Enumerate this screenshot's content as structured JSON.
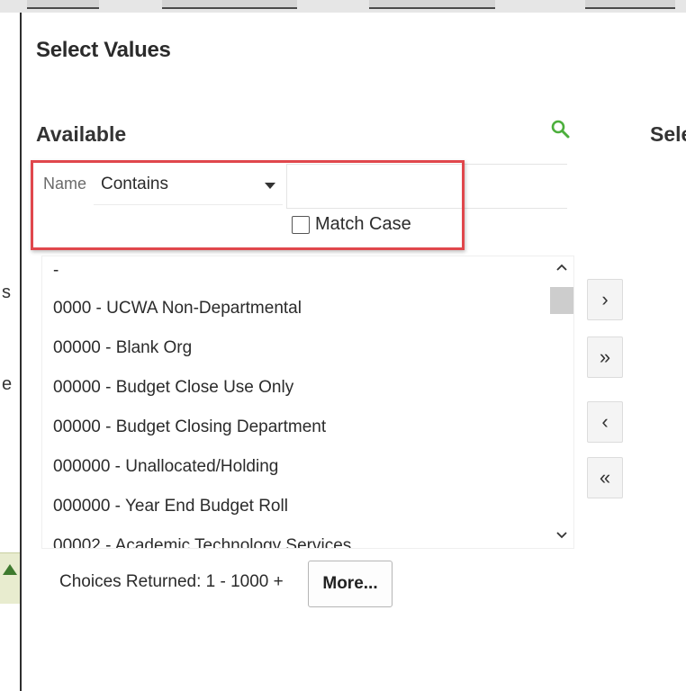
{
  "dialog": {
    "title": "Select Values"
  },
  "available": {
    "heading": "Available",
    "search_icon": "search-icon"
  },
  "selected": {
    "heading": "Sele"
  },
  "filter": {
    "field_label": "Name",
    "operator_value": "Contains",
    "search_value": "",
    "match_case_label": "Match Case",
    "match_case_checked": false,
    "highlight_color": "#e0474c"
  },
  "list": {
    "items": [
      "-",
      "0000 - UCWA Non-Departmental",
      "00000 - Blank Org",
      "00000 - Budget Close Use Only",
      "00000 - Budget Closing Department",
      "000000 - Unallocated/Holding",
      "000000 - Year End Budget Roll",
      "00002 - Academic Technology Services"
    ],
    "scroll_up_icon": "chevron-up-icon",
    "scroll_down_icon": "chevron-down-icon"
  },
  "move_buttons": {
    "move": "›",
    "move_all": "»",
    "remove": "‹",
    "remove_all": "«"
  },
  "footer": {
    "choices_text": "Choices Returned: 1 - 1000 +",
    "more_label": "More..."
  },
  "background": {
    "left_letter_s": "s",
    "left_letter_e": "e"
  }
}
